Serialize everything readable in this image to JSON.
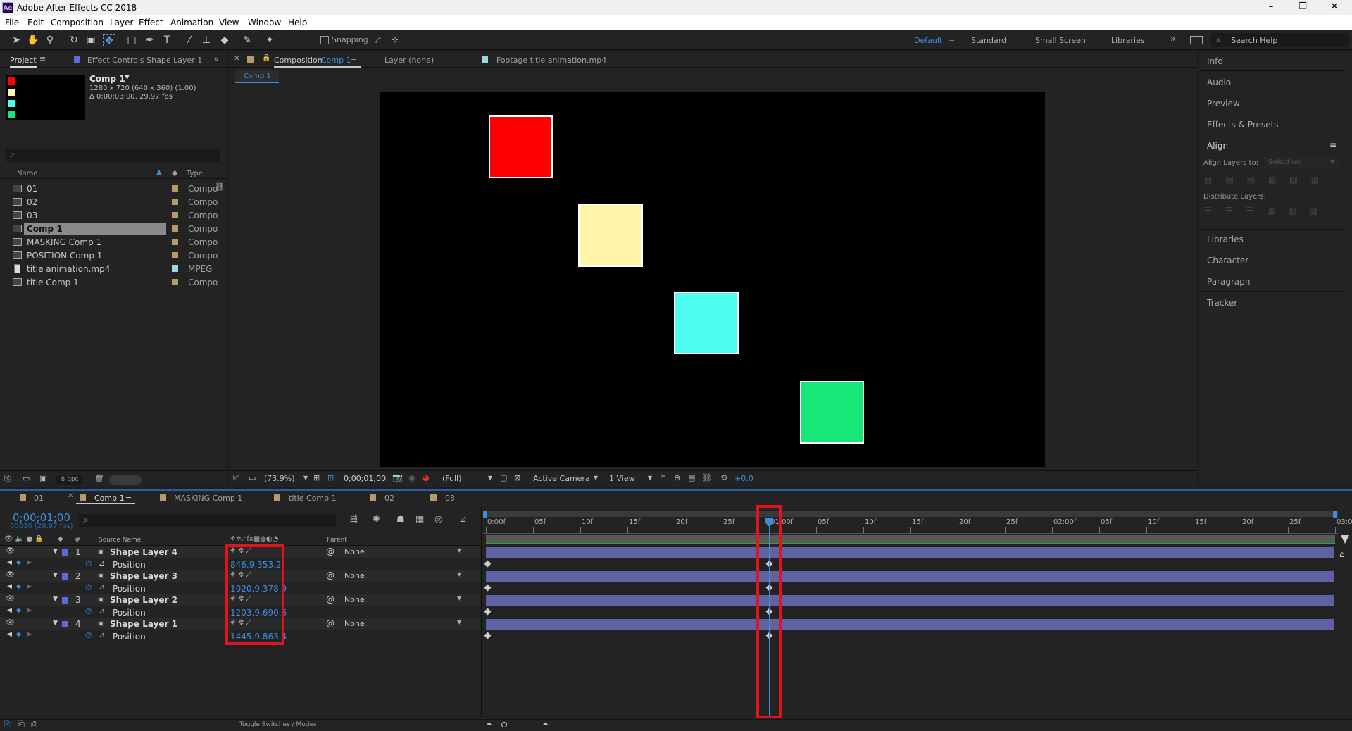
{
  "window": {
    "title": "Adobe After Effects CC 2018",
    "logo": "Ae",
    "minimize": "–",
    "restore": "❐",
    "close": "✕"
  },
  "menu": [
    "File",
    "Edit",
    "Composition",
    "Layer",
    "Effect",
    "Animation",
    "View",
    "Window",
    "Help"
  ],
  "toolbar": {
    "snapping_label": "Snapping",
    "workspaces": [
      "Default",
      "Standard",
      "Small Screen",
      "Libraries"
    ],
    "active_workspace": "Default",
    "search_help_placeholder": "Search Help"
  },
  "project_panel": {
    "tab_project": "Project",
    "tab_effect_controls": "Effect Controls Shape Layer 1",
    "comp_name": "Comp 1",
    "comp_size": "1280 x 720  (640 x 360) (1.00)",
    "comp_duration": "Δ 0;00;03;00, 29.97 fps",
    "col_name": "Name",
    "col_type": "Type",
    "items": [
      {
        "name": "01",
        "type": "Compo",
        "icon": "comp-icon"
      },
      {
        "name": "02",
        "type": "Compo",
        "icon": "comp-icon"
      },
      {
        "name": "03",
        "type": "Compo",
        "icon": "comp-icon"
      },
      {
        "name": "Comp 1",
        "type": "Compo",
        "icon": "comp-icon",
        "selected": true
      },
      {
        "name": "MASKING Comp 1",
        "type": "Compo",
        "icon": "comp-icon"
      },
      {
        "name": "POSITION Comp 1",
        "type": "Compo",
        "icon": "comp-icon"
      },
      {
        "name": "title animation.mp4",
        "type": "MPEG",
        "icon": "footage-icon"
      },
      {
        "name": "title Comp 1",
        "type": "Compo",
        "icon": "comp-icon"
      }
    ],
    "bpc": "8 bpc"
  },
  "viewer": {
    "tab_composition": "Composition",
    "tab_composition_name": "Comp 1",
    "tab_layer": "Layer (none)",
    "tab_footage": "Footage title animation.mp4",
    "breadcrumb": "Comp 1",
    "zoom": "(73.9%)",
    "timecode": "0;00;01;00",
    "resolution": "(Full)",
    "camera": "Active Camera",
    "views": "1 View",
    "exposure": "+0.0",
    "shapes": [
      {
        "name": "red-square",
        "color": "#ff0000"
      },
      {
        "name": "yellow-square",
        "color": "#fff4a8"
      },
      {
        "name": "cyan-square",
        "color": "#4dfdf0"
      },
      {
        "name": "green-square",
        "color": "#18e878"
      }
    ]
  },
  "right_panel": {
    "items_top": [
      "Info",
      "Audio",
      "Preview",
      "Effects & Presets"
    ],
    "align_title": "Align",
    "align_layers_to": "Align Layers to:",
    "align_target": "Selection",
    "distribute_layers": "Distribute Layers:",
    "items_bottom": [
      "Libraries",
      "Character",
      "Paragraph",
      "Tracker"
    ]
  },
  "timeline": {
    "tabs": [
      "01",
      "Comp 1",
      "MASKING Comp 1",
      "title Comp 1",
      "02",
      "03"
    ],
    "active_tab": "Comp 1",
    "timecode": "0;00;01;00",
    "frame_info": "00030 (29.97 fps)",
    "col_source_name": "Source Name",
    "col_parent": "Parent",
    "ruler_ticks": [
      "0:00f",
      "05f",
      "10f",
      "15f",
      "20f",
      "25f",
      "01:00f",
      "05f",
      "10f",
      "15f",
      "20f",
      "25f",
      "02:00f",
      "05f",
      "10f",
      "15f",
      "20f",
      "25f",
      "03:0"
    ],
    "layers": [
      {
        "num": "1",
        "name": "Shape Layer 4",
        "color": "#5a6bd8",
        "parent": "None",
        "prop": "Position",
        "value": "846.9,353.2"
      },
      {
        "num": "2",
        "name": "Shape Layer 3",
        "color": "#5a6bd8",
        "parent": "None",
        "prop": "Position",
        "value": "1020.9,378.9"
      },
      {
        "num": "3",
        "name": "Shape Layer 2",
        "color": "#5a6bd8",
        "parent": "None",
        "prop": "Position",
        "value": "1203.9,690.6"
      },
      {
        "num": "4",
        "name": "Shape Layer 1",
        "color": "#5a6bd8",
        "parent": "None",
        "prop": "Position",
        "value": "1445.9,863.4"
      }
    ],
    "toggle_label": "Toggle Switches / Modes"
  }
}
